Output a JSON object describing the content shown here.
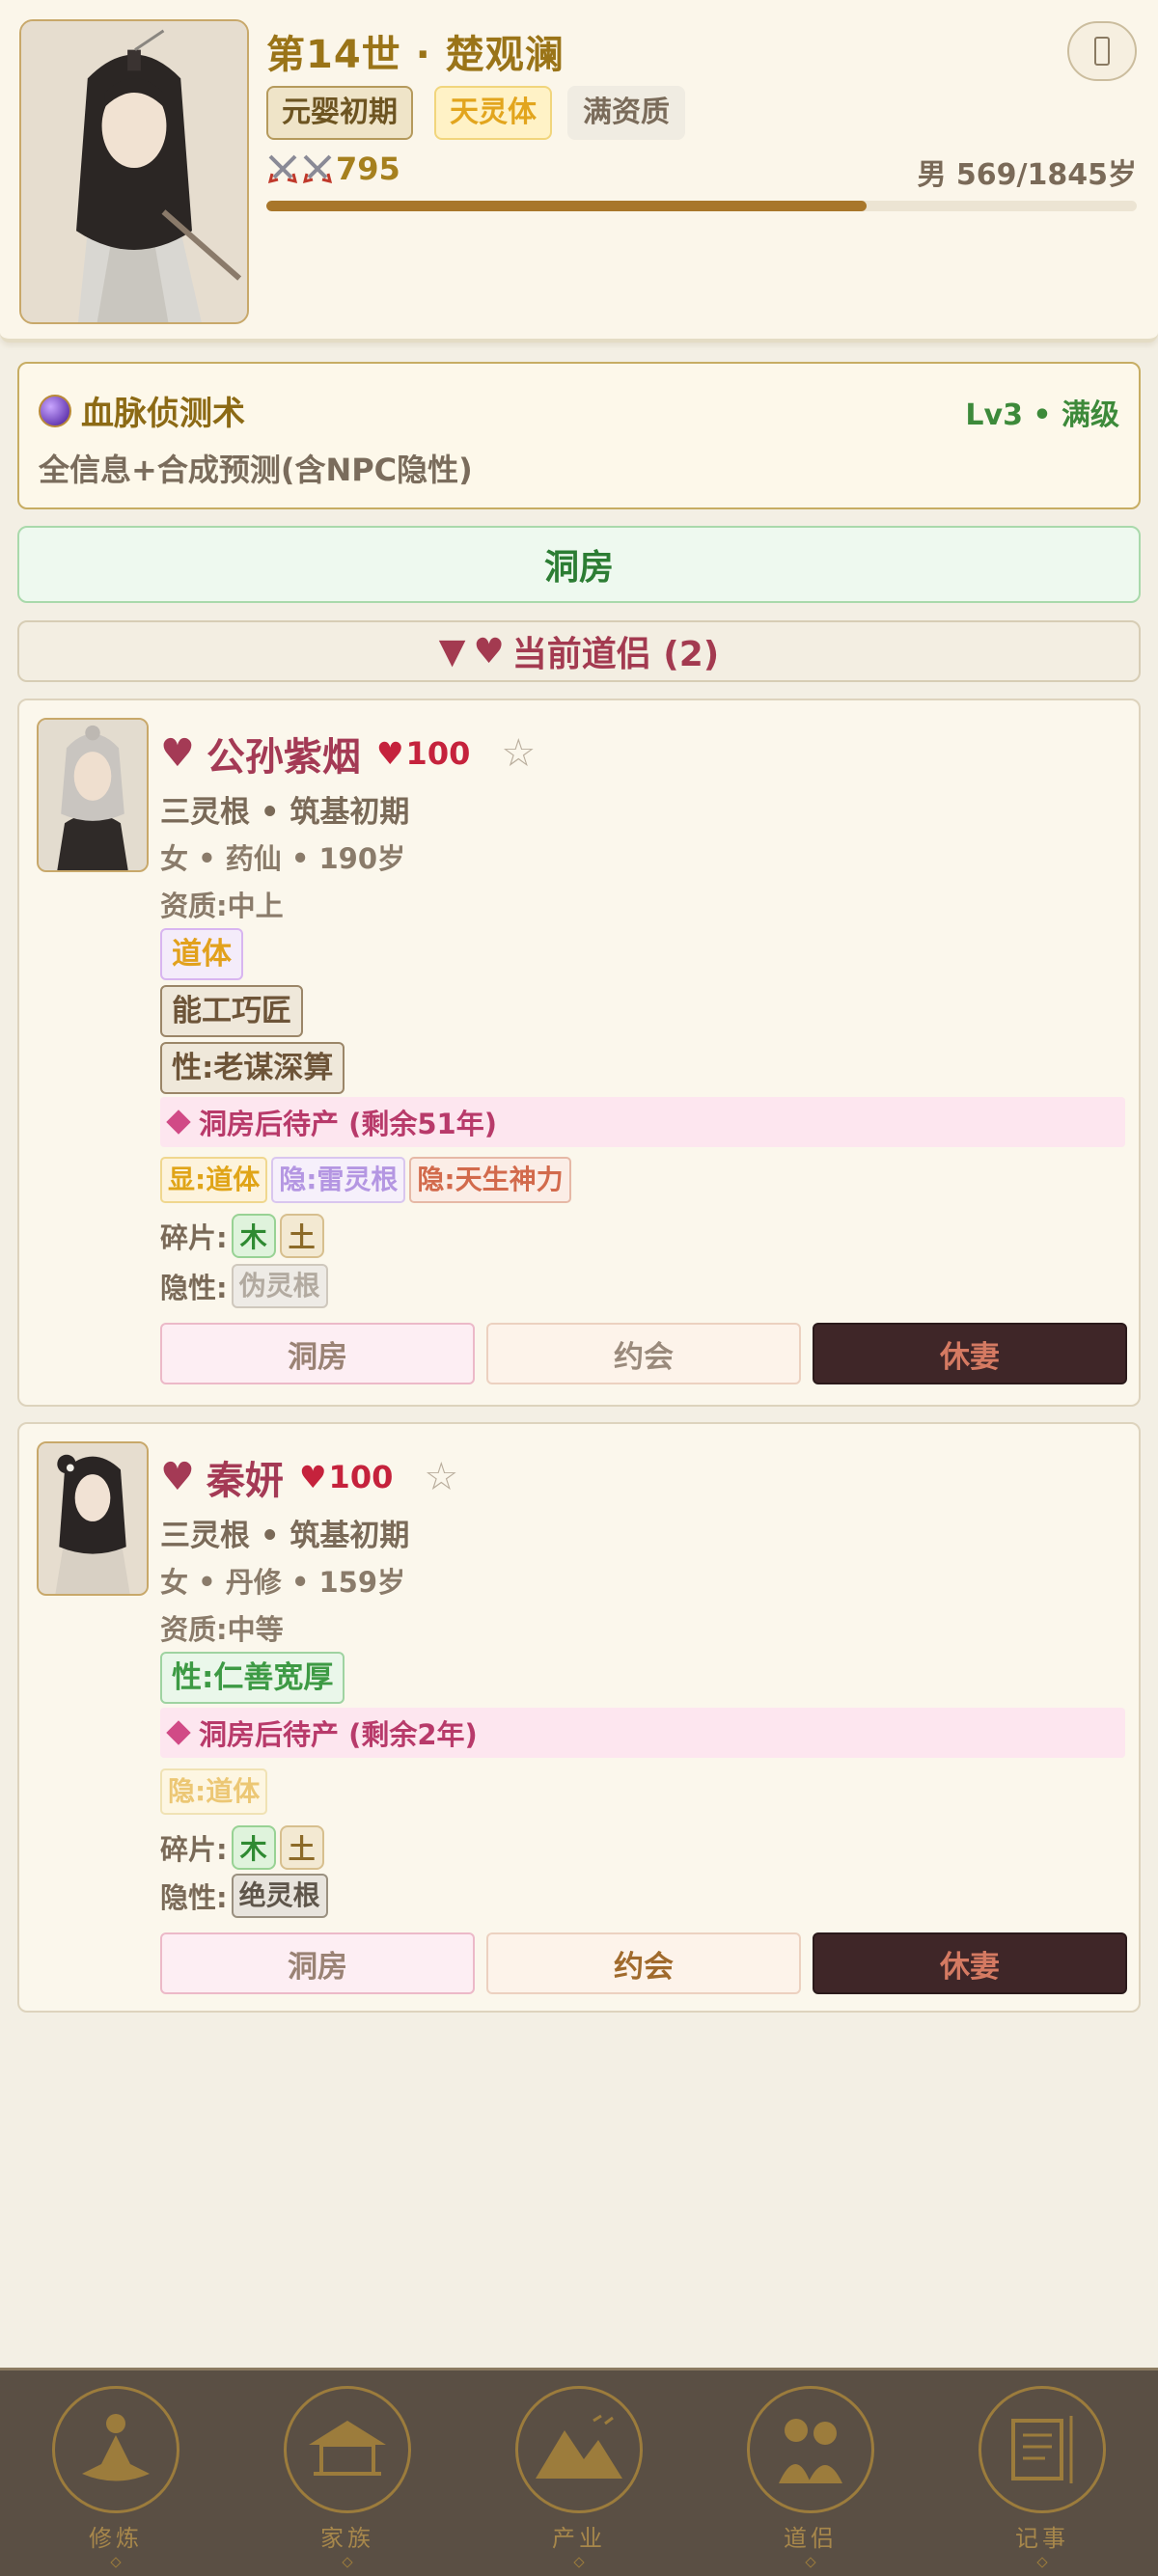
{
  "player": {
    "name": "第14世 · 楚观澜",
    "realm": "元婴初期",
    "body_type": "天灵体",
    "aptitude": "满资质",
    "power": "795",
    "age": "男 569/1845岁",
    "age_progress": 0.69,
    "menu_icon": "book-icon"
  },
  "skill": {
    "icon": "crystal-orb-icon",
    "title": "血脉侦测术",
    "level": "Lv3 • 满级",
    "desc": "全信息+合成预测(含NPC隐性)"
  },
  "primary_action": "洞房",
  "section": {
    "title": "当前道侣 (2)"
  },
  "partners": [
    {
      "name": "公孙紫烟",
      "affection": "100",
      "roots_realm": "三灵根 • 筑基初期",
      "info": "女 • 药仙 • 190岁",
      "aptitude": "资质:中上",
      "tags": [
        "道体",
        "能工巧匠",
        "性:老谋深算"
      ],
      "pending": "洞房后待产 (剩余51年)",
      "traits": [
        "显:道体",
        "隐:雷灵根",
        "隐:天生神力"
      ],
      "fragments_label": "碎片:",
      "fragments": [
        "木",
        "土"
      ],
      "hidden_label": "隐性:",
      "hidden": "伪灵根",
      "actions": [
        "洞房",
        "约会",
        "休妻"
      ]
    },
    {
      "name": "秦妍",
      "affection": "100",
      "roots_realm": "三灵根 • 筑基初期",
      "info": "女 • 丹修 • 159岁",
      "aptitude": "资质:中等",
      "tags": [
        "性:仁善宽厚"
      ],
      "pending": "洞房后待产 (剩余2年)",
      "traits": [
        "隐:道体"
      ],
      "fragments_label": "碎片:",
      "fragments": [
        "木",
        "土"
      ],
      "hidden_label": "隐性:",
      "hidden": "绝灵根",
      "actions": [
        "洞房",
        "约会",
        "休妻"
      ]
    }
  ],
  "nav": [
    {
      "label": "修炼",
      "icon": "meditation-icon"
    },
    {
      "label": "家族",
      "icon": "pavilion-icon"
    },
    {
      "label": "产业",
      "icon": "mountain-icon"
    },
    {
      "label": "道侣",
      "icon": "couple-icon"
    },
    {
      "label": "记事",
      "icon": "scroll-icon"
    }
  ]
}
